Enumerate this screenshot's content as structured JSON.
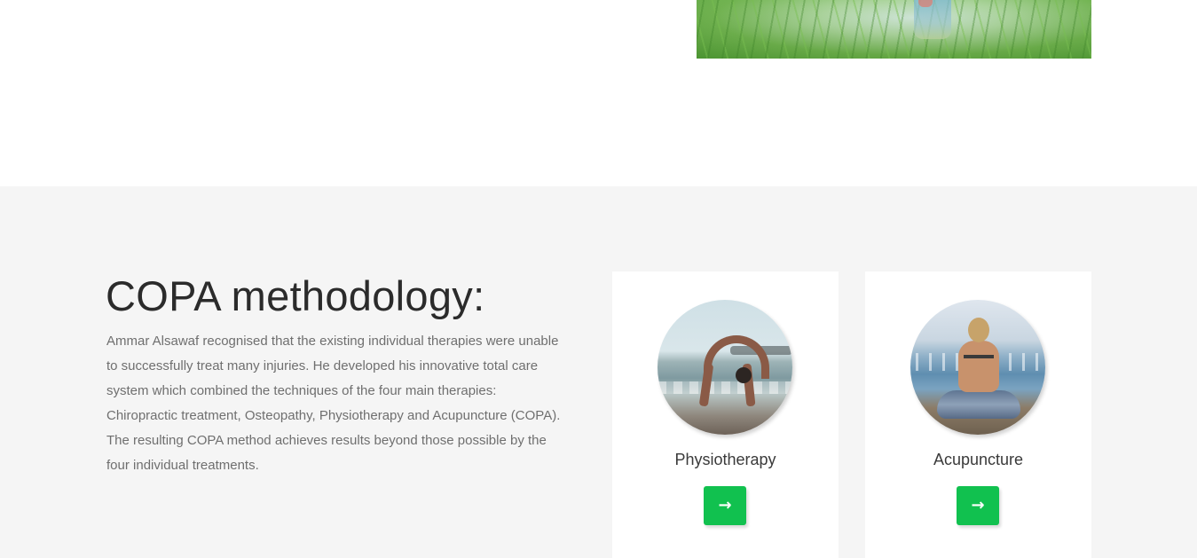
{
  "hero": {
    "image": "grass-field-photo"
  },
  "copa": {
    "title": "COPA methodology:",
    "description": "Ammar Alsawaf recognised that the existing individual therapies were unable to successfully treat many injuries. He developed his innovative total care system which combined the techniques of the four main therapies: Chiropractic treatment, Osteopathy, Physiotherapy and Acupuncture (COPA). The resulting COPA method achieves results beyond those possible by the four individual treatments."
  },
  "cards": [
    {
      "label": "Physiotherapy",
      "image": "woman-yoga-backbend-on-beach",
      "button_icon": "arrow-right-icon",
      "button_symbol": "→"
    },
    {
      "label": "Acupuncture",
      "image": "woman-meditating-by-sea",
      "button_icon": "arrow-right-icon",
      "button_symbol": "→"
    }
  ],
  "colors": {
    "section_background": "#f5f5f5",
    "button_green": "#11c14f",
    "card_background": "#ffffff"
  }
}
